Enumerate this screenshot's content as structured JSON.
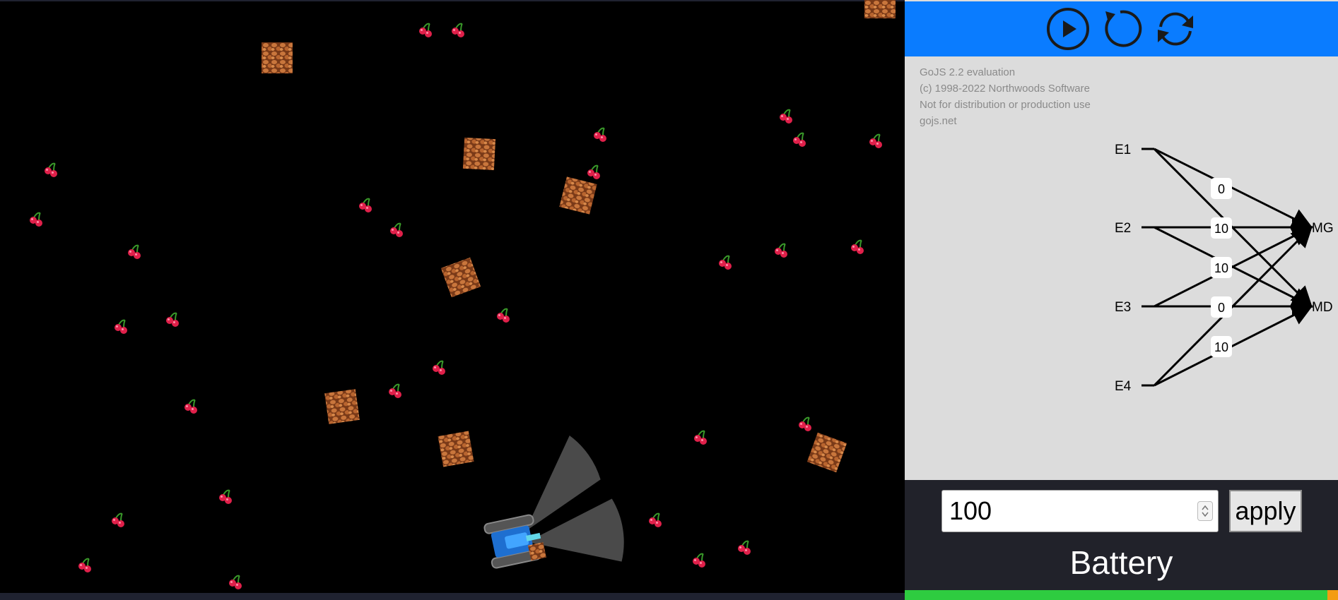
{
  "toolbar": {
    "play_icon": "play-circle-icon",
    "reset_icon": "rotate-ccw-icon",
    "refresh_icon": "refresh-cycle-icon"
  },
  "evaluation_notice": {
    "line1": "GoJS 2.2 evaluation",
    "line2": "(c) 1998-2022 Northwoods Software",
    "line3": "Not for distribution or production use",
    "line4": "gojs.net"
  },
  "network": {
    "inputs": [
      "E1",
      "E2",
      "E3",
      "E4"
    ],
    "outputs": [
      "MG",
      "MD"
    ],
    "weights": [
      "0",
      "10",
      "10",
      "0",
      "10"
    ]
  },
  "controls": {
    "value": "100",
    "apply_label": "apply",
    "battery_label": "Battery",
    "battery_level": 0.975
  },
  "colors": {
    "toolbar_blue": "#0a7cff",
    "battery_green": "#2ecc40",
    "battery_orange": "#f39c12",
    "cherry_red": "#e0204a",
    "crate_brown": "#a0542a"
  }
}
